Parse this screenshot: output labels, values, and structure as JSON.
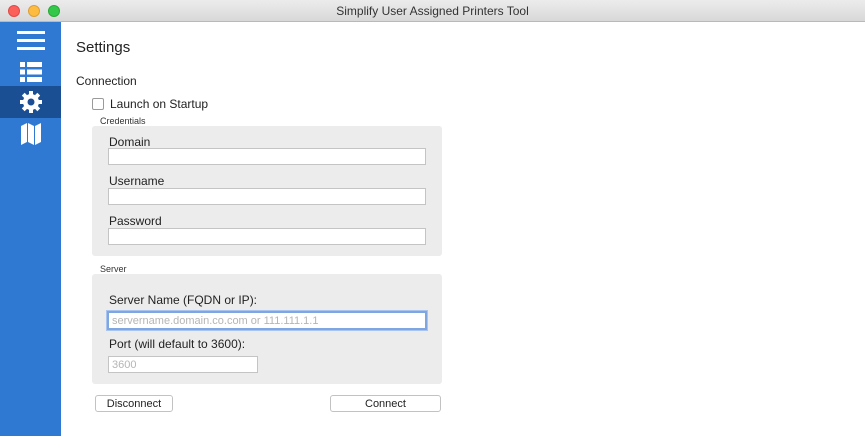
{
  "window": {
    "title": "Simplify User Assigned Printers Tool"
  },
  "sidebar": {
    "items": [
      {
        "icon": "hamburger-icon",
        "active": false
      },
      {
        "icon": "list-icon",
        "active": false
      },
      {
        "icon": "gear-icon",
        "active": true
      },
      {
        "icon": "map-icon",
        "active": false
      }
    ]
  },
  "page": {
    "title": "Settings",
    "connection_title": "Connection",
    "launch_on_startup": {
      "label": "Launch on Startup",
      "checked": false
    }
  },
  "credentials": {
    "group_label": "Credentials",
    "domain_label": "Domain",
    "domain_value": "",
    "username_label": "Username",
    "username_value": "",
    "password_label": "Password",
    "password_value": ""
  },
  "server": {
    "group_label": "Server",
    "name_label": "Server Name (FQDN or IP):",
    "name_placeholder": "servername.domain.co.com or 111.111.1.1",
    "port_label": "Port (will default to 3600):",
    "port_placeholder": "3600"
  },
  "buttons": {
    "disconnect": "Disconnect",
    "connect": "Connect"
  },
  "colors": {
    "sidebar": "#2f79d3",
    "sidebar_active": "#1b4f93",
    "group_background": "#ececec"
  }
}
